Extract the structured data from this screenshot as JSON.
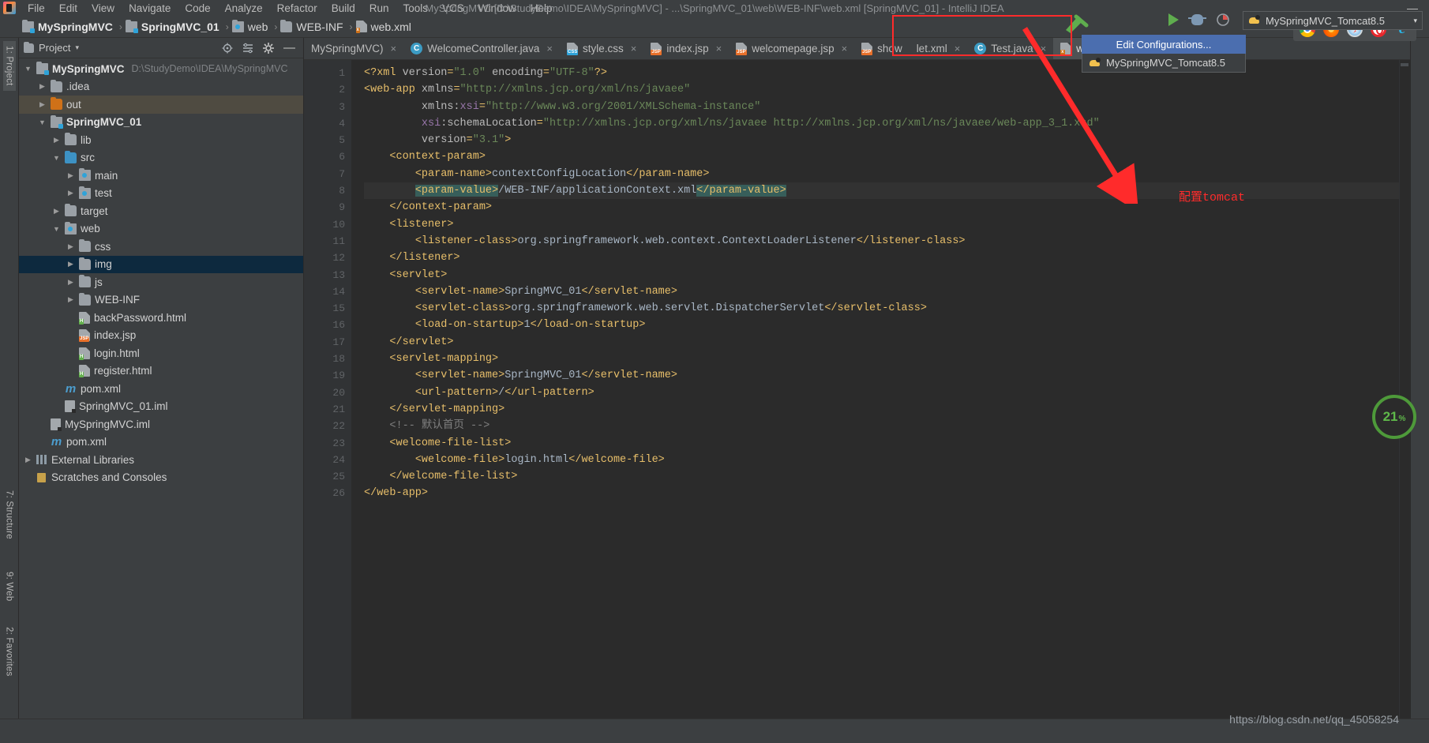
{
  "window": {
    "title": "MySpringMVC [D:\\StudyDemo\\IDEA\\MySpringMVC] - ...\\SpringMVC_01\\web\\WEB-INF\\web.xml [SpringMVC_01] - IntelliJ IDEA",
    "minimize_label": "—",
    "app_logo_name": "intellij-idea-logo"
  },
  "menu": [
    {
      "label": "File"
    },
    {
      "label": "Edit"
    },
    {
      "label": "View"
    },
    {
      "label": "Navigate"
    },
    {
      "label": "Code"
    },
    {
      "label": "Analyze"
    },
    {
      "label": "Refactor"
    },
    {
      "label": "Build"
    },
    {
      "label": "Run"
    },
    {
      "label": "Tools"
    },
    {
      "label": "VCS"
    },
    {
      "label": "Window"
    },
    {
      "label": "Help"
    }
  ],
  "breadcrumb": [
    {
      "label": "MySpringMVC",
      "icon": "module-icon",
      "bold": true
    },
    {
      "label": "SpringMVC_01",
      "icon": "module-icon",
      "bold": true
    },
    {
      "label": "web",
      "icon": "web-folder-icon",
      "bold": false
    },
    {
      "label": "WEB-INF",
      "icon": "folder-icon",
      "bold": false
    },
    {
      "label": "web.xml",
      "icon": "xml-file-icon",
      "bold": false
    }
  ],
  "breadcrumb_separator": "›",
  "run_config": {
    "selected": "MySpringMVC_Tomcat8.5",
    "dropdown_caret": "▾",
    "menu_items": [
      {
        "label": "MySpringMVC_Tomcat8.5",
        "selected": false,
        "icon": "tomcat-icon"
      },
      {
        "label": "Edit Configurations...",
        "selected": true,
        "icon": ""
      },
      {
        "label": "MySpringMVC_Tomcat8.5",
        "selected": false,
        "icon": "tomcat-icon"
      }
    ]
  },
  "project_panel": {
    "title": "Project",
    "collapse_caret": "▾",
    "tree": [
      {
        "label": "MySpringMVC",
        "sub": "D:\\StudyDemo\\IDEA\\MySpringMVC",
        "depth": 0,
        "arrow": "▼",
        "icon": "module-icon",
        "bold": true,
        "state": ""
      },
      {
        "label": ".idea",
        "sub": "",
        "depth": 1,
        "arrow": "▶",
        "icon": "folder-icon",
        "bold": false,
        "state": ""
      },
      {
        "label": "out",
        "sub": "",
        "depth": 1,
        "arrow": "▶",
        "icon": "folder-orange-icon",
        "bold": false,
        "state": "olive"
      },
      {
        "label": "SpringMVC_01",
        "sub": "",
        "depth": 1,
        "arrow": "▼",
        "icon": "module-icon",
        "bold": true,
        "state": ""
      },
      {
        "label": "lib",
        "sub": "",
        "depth": 2,
        "arrow": "▶",
        "icon": "folder-icon",
        "bold": false,
        "state": ""
      },
      {
        "label": "src",
        "sub": "",
        "depth": 2,
        "arrow": "▼",
        "icon": "folder-blue-icon",
        "bold": false,
        "state": ""
      },
      {
        "label": "main",
        "sub": "",
        "depth": 3,
        "arrow": "▶",
        "icon": "source-folder-icon",
        "bold": false,
        "state": ""
      },
      {
        "label": "test",
        "sub": "",
        "depth": 3,
        "arrow": "▶",
        "icon": "source-folder-icon",
        "bold": false,
        "state": ""
      },
      {
        "label": "target",
        "sub": "",
        "depth": 2,
        "arrow": "▶",
        "icon": "folder-icon",
        "bold": false,
        "state": ""
      },
      {
        "label": "web",
        "sub": "",
        "depth": 2,
        "arrow": "▼",
        "icon": "web-folder-icon",
        "bold": false,
        "state": ""
      },
      {
        "label": "css",
        "sub": "",
        "depth": 3,
        "arrow": "▶",
        "icon": "folder-icon",
        "bold": false,
        "state": ""
      },
      {
        "label": "img",
        "sub": "",
        "depth": 3,
        "arrow": "▶",
        "icon": "folder-icon",
        "bold": false,
        "state": "selected"
      },
      {
        "label": "js",
        "sub": "",
        "depth": 3,
        "arrow": "▶",
        "icon": "folder-icon",
        "bold": false,
        "state": ""
      },
      {
        "label": "WEB-INF",
        "sub": "",
        "depth": 3,
        "arrow": "▶",
        "icon": "folder-icon",
        "bold": false,
        "state": ""
      },
      {
        "label": "backPassword.html",
        "sub": "",
        "depth": 3,
        "arrow": "",
        "icon": "html-file-icon",
        "bold": false,
        "state": ""
      },
      {
        "label": "index.jsp",
        "sub": "",
        "depth": 3,
        "arrow": "",
        "icon": "jsp-file-icon",
        "bold": false,
        "state": ""
      },
      {
        "label": "login.html",
        "sub": "",
        "depth": 3,
        "arrow": "",
        "icon": "html-file-icon",
        "bold": false,
        "state": ""
      },
      {
        "label": "register.html",
        "sub": "",
        "depth": 3,
        "arrow": "",
        "icon": "html-file-icon",
        "bold": false,
        "state": ""
      },
      {
        "label": "pom.xml",
        "sub": "",
        "depth": 2,
        "arrow": "",
        "icon": "maven-file-icon",
        "bold": false,
        "state": ""
      },
      {
        "label": "SpringMVC_01.iml",
        "sub": "",
        "depth": 2,
        "arrow": "",
        "icon": "iml-file-icon",
        "bold": false,
        "state": ""
      },
      {
        "label": "MySpringMVC.iml",
        "sub": "",
        "depth": 1,
        "arrow": "",
        "icon": "iml-file-icon",
        "bold": false,
        "state": ""
      },
      {
        "label": "pom.xml",
        "sub": "",
        "depth": 1,
        "arrow": "",
        "icon": "maven-file-icon",
        "bold": false,
        "state": ""
      },
      {
        "label": "External Libraries",
        "sub": "",
        "depth": 0,
        "arrow": "▶",
        "icon": "library-icon",
        "bold": false,
        "state": ""
      },
      {
        "label": "Scratches and Consoles",
        "sub": "",
        "depth": 0,
        "arrow": "",
        "icon": "scratch-icon",
        "bold": false,
        "state": ""
      }
    ]
  },
  "left_rail": [
    {
      "label": "1: Project",
      "active": true
    },
    {
      "label": "7: Structure",
      "active": false
    },
    {
      "label": "9: Web",
      "active": false
    },
    {
      "label": "2: Favorites",
      "active": false
    }
  ],
  "editor_tabs": [
    {
      "label": "MySpringMVC)",
      "icon": "",
      "active": false,
      "closable": true
    },
    {
      "label": "WelcomeController.java",
      "icon": "java-class-icon",
      "active": false,
      "closable": true
    },
    {
      "label": "style.css",
      "icon": "css-file-icon",
      "active": false,
      "closable": true
    },
    {
      "label": "index.jsp",
      "icon": "jsp-file-icon",
      "active": false,
      "closable": true
    },
    {
      "label": "welcomepage.jsp",
      "icon": "jsp-file-icon",
      "active": false,
      "closable": true
    },
    {
      "label": "show",
      "icon": "jsp-file-icon",
      "active": false,
      "closable": false
    },
    {
      "label": "let.xml",
      "icon": "",
      "active": false,
      "closable": true
    },
    {
      "label": "Test.java",
      "icon": "java-class-icon",
      "active": false,
      "closable": true
    },
    {
      "label": "we",
      "icon": "xml-file-icon",
      "active": true,
      "closable": false
    }
  ],
  "code": {
    "language": "xml",
    "current_line": 8,
    "lines": [
      {
        "n": 1,
        "fold": "",
        "bulb": false,
        "cur": false,
        "html": "<span class='tag'>&lt;?xml</span> <span class='attr'>version</span><span class='tag'>=</span><span class='val'>\"1.0\"</span> <span class='attr'>encoding</span><span class='tag'>=</span><span class='val'>\"UTF-8\"</span><span class='tag'>?&gt;</span>"
      },
      {
        "n": 2,
        "fold": "minus",
        "bulb": false,
        "cur": false,
        "html": "<span class='tag'>&lt;web-app</span> <span class='attr'>xmlns</span><span class='tag'>=</span><span class='val'>\"http://xmlns.jcp.org/xml/ns/javaee\"</span>"
      },
      {
        "n": 3,
        "fold": "",
        "bulb": false,
        "cur": false,
        "html": "         <span class='attr'>xmlns:</span><span class='attrns'>xsi</span><span class='tag'>=</span><span class='val'>\"http://www.w3.org/2001/XMLSchema-instance\"</span>"
      },
      {
        "n": 4,
        "fold": "",
        "bulb": false,
        "cur": false,
        "html": "         <span class='attrns'>xsi</span><span class='attr'>:schemaLocation</span><span class='tag'>=</span><span class='val'>\"http://xmlns.jcp.org/xml/ns/javaee http://xmlns.jcp.org/xml/ns/javaee/web-app_3_1.xsd\"</span>"
      },
      {
        "n": 5,
        "fold": "",
        "bulb": false,
        "cur": false,
        "html": "         <span class='attr'>version</span><span class='tag'>=</span><span class='val'>\"3.1\"</span><span class='tag'>&gt;</span>"
      },
      {
        "n": 6,
        "fold": "minus",
        "bulb": false,
        "cur": false,
        "html": "    <span class='tag'>&lt;context-param&gt;</span>"
      },
      {
        "n": 7,
        "fold": "",
        "bulb": false,
        "cur": false,
        "html": "        <span class='tag'>&lt;param-name&gt;</span><span class='txt'>contextConfigLocation</span><span class='tag'>&lt;/param-name&gt;</span>"
      },
      {
        "n": 8,
        "fold": "",
        "bulb": true,
        "cur": true,
        "html": "        <span class='tag hl'>&lt;param-value&gt;</span><span class='txt'>/WEB-INF/applicationContext.xml</span><span class='tag hl'>&lt;/param-value&gt;</span>"
      },
      {
        "n": 9,
        "fold": "end",
        "bulb": false,
        "cur": false,
        "html": "    <span class='tag'>&lt;/context-param&gt;</span>"
      },
      {
        "n": 10,
        "fold": "minus",
        "bulb": false,
        "cur": false,
        "html": "    <span class='tag'>&lt;listener&gt;</span>"
      },
      {
        "n": 11,
        "fold": "",
        "bulb": false,
        "cur": false,
        "html": "        <span class='tag'>&lt;listener-class&gt;</span><span class='txt'>org.springframework.web.context.ContextLoaderListener</span><span class='tag'>&lt;/listener-class&gt;</span>"
      },
      {
        "n": 12,
        "fold": "end",
        "bulb": false,
        "cur": false,
        "html": "    <span class='tag'>&lt;/listener&gt;</span>"
      },
      {
        "n": 13,
        "fold": "minus",
        "bulb": false,
        "cur": false,
        "html": "    <span class='tag'>&lt;servlet&gt;</span>"
      },
      {
        "n": 14,
        "fold": "",
        "bulb": false,
        "cur": false,
        "html": "        <span class='tag'>&lt;servlet-name&gt;</span><span class='txt'>SpringMVC_01</span><span class='tag'>&lt;/servlet-name&gt;</span>"
      },
      {
        "n": 15,
        "fold": "",
        "bulb": false,
        "cur": false,
        "html": "        <span class='tag'>&lt;servlet-class&gt;</span><span class='txt'>org.springframework.web.servlet.DispatcherServlet</span><span class='tag'>&lt;/servlet-class&gt;</span>"
      },
      {
        "n": 16,
        "fold": "",
        "bulb": false,
        "cur": false,
        "html": "        <span class='tag'>&lt;load-on-startup&gt;</span><span class='txt'>1</span><span class='tag'>&lt;/load-on-startup&gt;</span>"
      },
      {
        "n": 17,
        "fold": "end",
        "bulb": false,
        "cur": false,
        "html": "    <span class='tag'>&lt;/servlet&gt;</span>"
      },
      {
        "n": 18,
        "fold": "minus",
        "bulb": false,
        "cur": false,
        "html": "    <span class='tag'>&lt;servlet-mapping&gt;</span>"
      },
      {
        "n": 19,
        "fold": "",
        "bulb": false,
        "cur": false,
        "html": "        <span class='tag'>&lt;servlet-name&gt;</span><span class='txt'>SpringMVC_01</span><span class='tag'>&lt;/servlet-name&gt;</span>"
      },
      {
        "n": 20,
        "fold": "",
        "bulb": false,
        "cur": false,
        "html": "        <span class='tag'>&lt;url-pattern&gt;</span><span class='txt'>/</span><span class='tag'>&lt;/url-pattern&gt;</span>"
      },
      {
        "n": 21,
        "fold": "end",
        "bulb": false,
        "cur": false,
        "html": "    <span class='tag'>&lt;/servlet-mapping&gt;</span>"
      },
      {
        "n": 22,
        "fold": "",
        "bulb": false,
        "cur": false,
        "html": "    <span class='com'>&lt;!-- 默认首页 --&gt;</span>"
      },
      {
        "n": 23,
        "fold": "minus",
        "bulb": false,
        "cur": false,
        "html": "    <span class='tag'>&lt;welcome-file-list&gt;</span>"
      },
      {
        "n": 24,
        "fold": "",
        "bulb": false,
        "cur": false,
        "html": "        <span class='tag'>&lt;welcome-file&gt;</span><span class='txt'>login.html</span><span class='tag'>&lt;/welcome-file&gt;</span>"
      },
      {
        "n": 25,
        "fold": "end",
        "bulb": false,
        "cur": false,
        "html": "    <span class='tag'>&lt;/welcome-file-list&gt;</span>"
      },
      {
        "n": 26,
        "fold": "end",
        "bulb": false,
        "cur": false,
        "html": "<span class='tag'>&lt;/web-app&gt;</span>"
      }
    ]
  },
  "browsers": [
    {
      "name": "chrome-icon"
    },
    {
      "name": "firefox-icon"
    },
    {
      "name": "safari-icon"
    },
    {
      "name": "opera-icon"
    },
    {
      "name": "internet-explorer-icon"
    }
  ],
  "annotation": {
    "text": "配置tomcat",
    "color": "#ff2b2b"
  },
  "zoom_badge": {
    "value": "21",
    "unit": "%",
    "ring_color": "#4e9a3a"
  },
  "watermark": "https://blog.csdn.net/qq_45058254",
  "colors": {
    "accent_blue": "#4b6eaf",
    "selection_blue": "#0d293e",
    "annotation_red": "#ff2b2b",
    "editor_bg": "#2b2b2b",
    "panel_bg": "#3c3f41"
  }
}
